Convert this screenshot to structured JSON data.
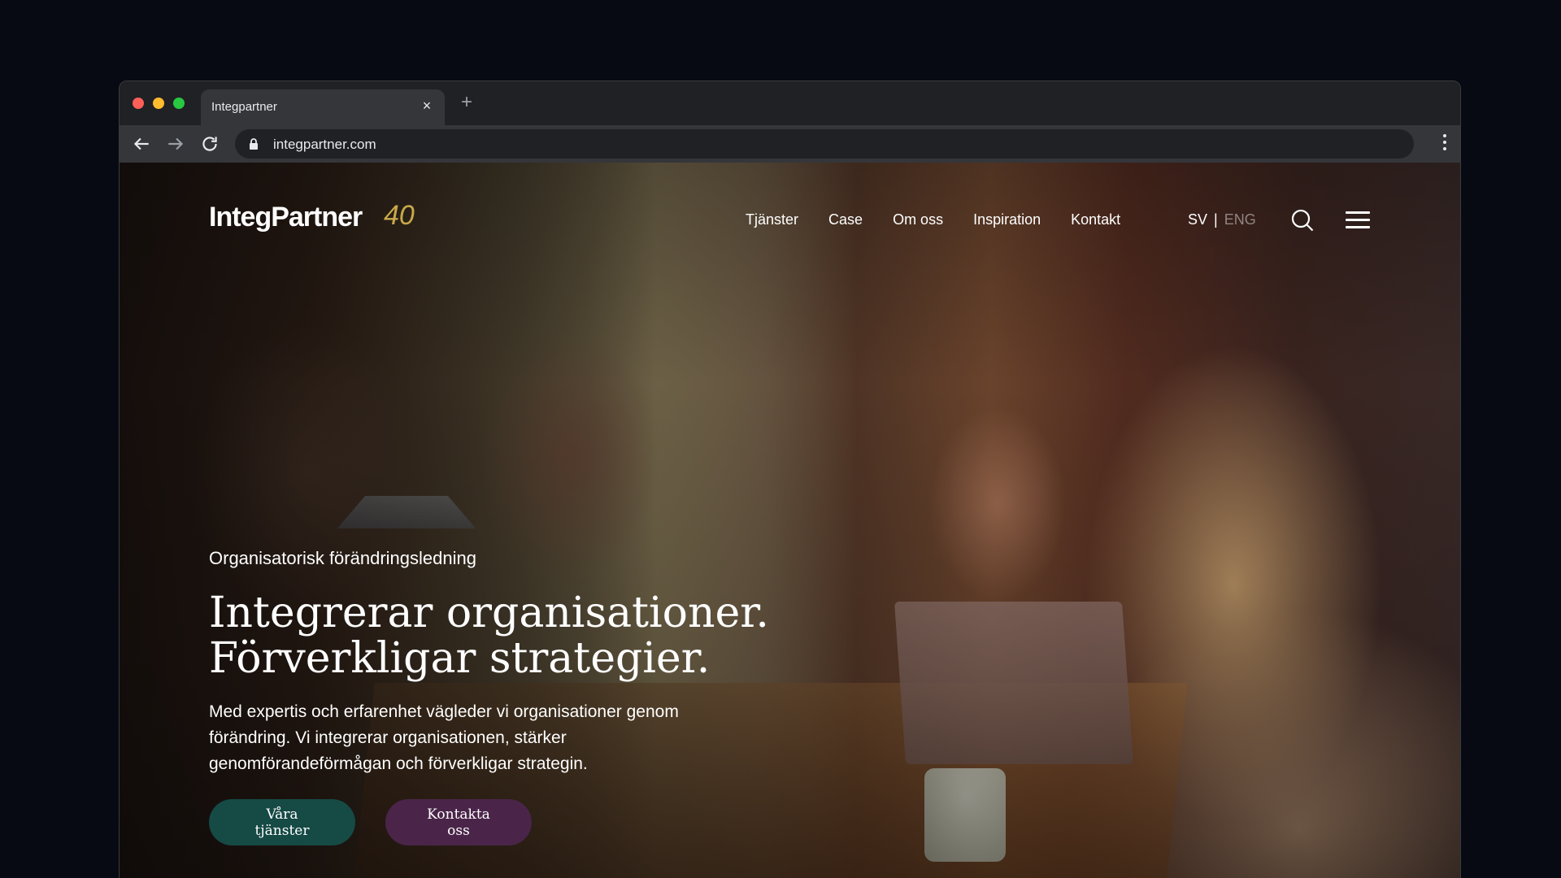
{
  "browser": {
    "tab_title": "Integpartner",
    "tab_close": "×",
    "new_tab": "+",
    "url": "integpartner.com"
  },
  "site": {
    "logo_text": "IntegPartner",
    "logo_badge": "40",
    "nav": [
      "Tjänster",
      "Case",
      "Om oss",
      "Inspiration",
      "Kontakt"
    ],
    "lang": {
      "sv": "SV",
      "separator": "|",
      "eng": "ENG"
    }
  },
  "hero": {
    "eyebrow": "Organisatorisk förändringsledning",
    "headline_line1": "Integrerar organisationer.",
    "headline_line2": "Förverkligar strategier.",
    "lead": "Med expertis och erfarenhet vägleder vi organisationer genom förändring. Vi integrerar organisationen, stärker genomförandeförmågan och förverkligar strategin.",
    "cta_primary": "Våra tjänster",
    "cta_secondary": "Kontakta oss"
  },
  "colors": {
    "primary_button": "#164a45",
    "secondary_button": "#4a2549",
    "logo_accent": "#c9a94a"
  },
  "icons": {
    "back": "arrow-left-icon",
    "forward": "arrow-right-icon",
    "reload": "reload-icon",
    "lock": "lock-icon",
    "menu": "kebab-menu-icon",
    "search": "search-icon",
    "hamburger": "hamburger-menu-icon"
  }
}
